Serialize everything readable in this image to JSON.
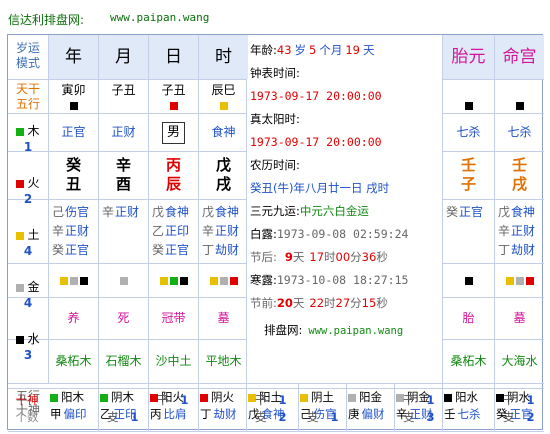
{
  "header": {
    "brand": "信达利排盘网:",
    "url": "www.paipan.wang"
  },
  "side": {
    "yun1": "岁运",
    "yun2": "模式",
    "gan1": "天干",
    "gan2": "五行",
    "wx": [
      {
        "name": "木",
        "count": "1",
        "color": "#12b012"
      },
      {
        "name": "火",
        "count": "2",
        "color": "#e00000"
      },
      {
        "name": "土",
        "count": "4",
        "color": "#e8c000"
      },
      {
        "name": "金",
        "count": "4",
        "color": "#b0b0b0"
      },
      {
        "name": "水",
        "count": "3",
        "color": "#000000"
      }
    ]
  },
  "cols": [
    {
      "title": "年",
      "rowlabel": "寅卯",
      "sq1": "#000000",
      "shishen": "正官",
      "gan": "癸",
      "zhi": "丑",
      "ganColor": "#000",
      "zhiColor": "#000",
      "canggan": [
        [
          "己",
          "伤官"
        ],
        [
          "辛",
          "正财"
        ],
        [
          "癸",
          "正官"
        ]
      ],
      "squares": [
        "#e8c000",
        "#b0b0b0",
        "#000000"
      ],
      "changsheng": "养",
      "nayin": "桑柘木"
    },
    {
      "title": "月",
      "rowlabel": "子丑",
      "sq1": "",
      "shishen": "正财",
      "gan": "辛",
      "zhi": "酉",
      "ganColor": "#000",
      "zhiColor": "#000",
      "canggan": [
        [
          "辛",
          "正财"
        ],
        [
          "",
          ""
        ],
        [
          "",
          ""
        ]
      ],
      "squares": [
        "#b0b0b0"
      ],
      "changsheng": "死",
      "nayin": "石榴木"
    },
    {
      "title": "日",
      "rowlabel": "子丑",
      "sq1": "#e00000",
      "shishen": "男",
      "gan": "丙",
      "zhi": "辰",
      "ganColor": "#e00000",
      "zhiColor": "#e00000",
      "canggan": [
        [
          "戊",
          "食神"
        ],
        [
          "乙",
          "正印"
        ],
        [
          "癸",
          "正官"
        ]
      ],
      "squares": [
        "#e8c000",
        "#12b012",
        "#000000"
      ],
      "changsheng": "冠带",
      "nayin": "沙中土"
    },
    {
      "title": "时",
      "rowlabel": "辰巳",
      "sq1": "#e8c000",
      "shishen": "食神",
      "gan": "戊",
      "zhi": "戌",
      "ganColor": "#000",
      "zhiColor": "#000",
      "canggan": [
        [
          "戊",
          "食神"
        ],
        [
          "辛",
          "正财"
        ],
        [
          "丁",
          "劫财"
        ]
      ],
      "squares": [
        "#e8c000",
        "#b0b0b0",
        "#e00000"
      ],
      "changsheng": "墓",
      "nayin": "平地木"
    }
  ],
  "middle": {
    "age_label": "年龄:",
    "age_y": "43",
    "age_yu": "岁",
    "age_m": "5",
    "age_mu": "个月",
    "age_d": "19",
    "age_du": "天",
    "zhongbiao_label": "钟表时间:",
    "zhongbiao": "1973-09-17 20:00:00",
    "zhentaiyang_label": "真太阳时:",
    "zhentaiyang": "1973-09-17 20:00:00",
    "nongli_label": "农历时间:",
    "nongli": "癸丑(牛)年八月廿一日 戌时",
    "sanyuan_label": "三元九运:",
    "sanyuan": "中元六白金运",
    "bailu_label": "白露:",
    "bailu": "1973-09-08 02:59:24",
    "jiehou_label": "节后:",
    "jiehou_d": "9",
    "jiehou_du": "天",
    "jiehou_h": "17",
    "jiehou_hu": "时",
    "jiehou_mi": "00",
    "jiehou_miu": "分",
    "jiehou_s": "36",
    "jiehou_su": "秒",
    "hanlu_label": "寒露:",
    "hanlu": "1973-10-08 18:27:15",
    "jieqian_label": "节前:",
    "jieqian_d": "20",
    "jieqian_du": "天",
    "jieqian_h": "22",
    "jieqian_hu": "时",
    "jieqian_mi": "27",
    "jieqian_miu": "分",
    "jieqian_s": "15",
    "jieqian_su": "秒",
    "paipan_label": "排盘网:",
    "paipan_url": "www.paipan.wang"
  },
  "right": [
    {
      "title": "胎元",
      "sq": "#000000",
      "shishen": "七杀",
      "gan": "壬",
      "zhi": "子",
      "canggan": [
        [
          "癸",
          "正官"
        ],
        [
          "",
          ""
        ],
        [
          "",
          ""
        ]
      ],
      "squares": [
        "#000000"
      ],
      "changsheng": "胎",
      "nayin": "桑柘木"
    },
    {
      "title": "命宫",
      "sq": "#000000",
      "shishen": "七杀",
      "gan": "壬",
      "zhi": "戌",
      "canggan": [
        [
          "戊",
          "食神"
        ],
        [
          "辛",
          "正财"
        ],
        [
          "丁",
          "劫财"
        ]
      ],
      "squares": [
        "#e8c000",
        "#b0b0b0",
        "#e00000"
      ],
      "changsheng": "墓",
      "nayin": "大海水"
    }
  ],
  "bottom": {
    "label1": "五行",
    "label2": "十神",
    "label3": "十神",
    "label4": "个数",
    "items": [
      {
        "color": "#12b012",
        "yy": "阳木",
        "gan": "甲",
        "ss": "偏印",
        "gz": [
          "",
          ""
        ],
        "zz": [
          "",
          ""
        ]
      },
      {
        "color": "#12b012",
        "yy": "阴木",
        "gan": "乙",
        "ss": "正印",
        "gz": [
          "",
          ""
        ],
        "zz": [
          "支",
          "1"
        ]
      },
      {
        "color": "#e00000",
        "yy": "阳火",
        "gan": "丙",
        "ss": "比肩",
        "gz": [
          "干",
          "1"
        ],
        "zz": [
          "",
          ""
        ]
      },
      {
        "color": "#e00000",
        "yy": "阴火",
        "gan": "丁",
        "ss": "劫财",
        "gz": [
          "",
          ""
        ],
        "zz": [
          "",
          ""
        ]
      },
      {
        "color": "#e8c000",
        "yy": "阳土",
        "gan": "戊",
        "ss": "食神",
        "gz": [
          "干",
          "1"
        ],
        "zz": [
          "支",
          "2"
        ]
      },
      {
        "color": "#e8c000",
        "yy": "阴土",
        "gan": "己",
        "ss": "伤官",
        "gz": [
          "",
          ""
        ],
        "zz": [
          "支",
          "1"
        ]
      },
      {
        "color": "#b0b0b0",
        "yy": "阳金",
        "gan": "庚",
        "ss": "偏财",
        "gz": [
          "",
          ""
        ],
        "zz": [
          "",
          ""
        ]
      },
      {
        "color": "#b0b0b0",
        "yy": "阴金",
        "gan": "辛",
        "ss": "正财",
        "gz": [
          "干",
          "1"
        ],
        "zz": [
          "支",
          "3"
        ]
      },
      {
        "color": "#000000",
        "yy": "阳水",
        "gan": "壬",
        "ss": "七杀",
        "gz": [
          "",
          ""
        ],
        "zz": [
          "",
          ""
        ]
      },
      {
        "color": "#000000",
        "yy": "阴水",
        "gan": "癸",
        "ss": "正官",
        "gz": [
          "干",
          "1"
        ],
        "zz": [
          "支",
          "2"
        ]
      }
    ]
  }
}
